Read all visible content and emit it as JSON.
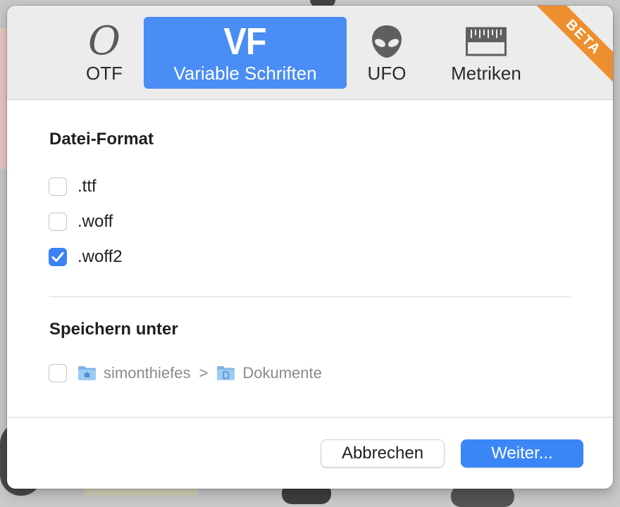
{
  "tabs": [
    {
      "label": "OTF",
      "icon": "otf-icon",
      "glyph": "O",
      "selected": false
    },
    {
      "label": "Variable Schriften",
      "icon": "vf-icon",
      "glyph": "VF",
      "selected": true
    },
    {
      "label": "UFO",
      "icon": "alien-icon",
      "selected": false
    },
    {
      "label": "Metriken",
      "icon": "ruler-icon",
      "selected": false
    }
  ],
  "badge": "BETA",
  "file_format": {
    "title": "Datei-Format",
    "options": [
      {
        "label": ".ttf",
        "checked": false
      },
      {
        "label": ".woff",
        "checked": false
      },
      {
        "label": ".woff2",
        "checked": true
      }
    ]
  },
  "save_location": {
    "title": "Speichern unter",
    "checked": false,
    "path": [
      {
        "name": "simonthiefes",
        "icon": "home-folder-icon"
      },
      {
        "name": "Dokumente",
        "icon": "documents-folder-icon"
      }
    ],
    "separator": ">"
  },
  "buttons": {
    "cancel": "Abbrechen",
    "continue": "Weiter..."
  },
  "colors": {
    "accent": "#3b86f6",
    "beta": "#ed8f2f"
  }
}
